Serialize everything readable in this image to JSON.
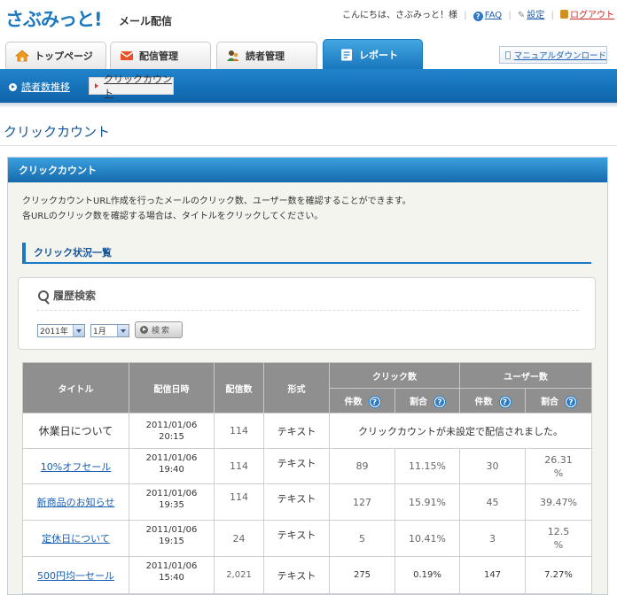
{
  "header": {
    "logo": "さぶみっと!",
    "logo_sub": "メール配信",
    "greeting": "こんにちは、さぶみっと！様",
    "faq": "FAQ",
    "settings": "設定",
    "logout": "ログアウト"
  },
  "tabs": [
    {
      "label": "トップページ",
      "icon": "home-icon"
    },
    {
      "label": "配信管理",
      "icon": "mail-icon"
    },
    {
      "label": "読者管理",
      "icon": "readers-icon"
    },
    {
      "label": "レポート",
      "icon": "report-icon",
      "active": true
    }
  ],
  "manual_download": "マニュアルダウンロード",
  "subnav": {
    "items": [
      "読者数推移"
    ],
    "current": "クリックカウント"
  },
  "page_title": "クリックカウント",
  "panel": {
    "title": "クリックカウント",
    "desc_line1": "クリックカウントURL作成を行ったメールのクリック数、ユーザー数を確認することができます。",
    "desc_line2": "各URLのクリック数を確認する場合は、タイトルをクリックしてください。",
    "section_title": "クリック状況一覧"
  },
  "search": {
    "title": "履歴検索",
    "year": "2011年",
    "month": "1月",
    "button": "検索"
  },
  "table": {
    "headers": {
      "title": "タイトル",
      "date": "配信日時",
      "count": "配信数",
      "format": "形式",
      "click_group": "クリック数",
      "user_group": "ユーザー数",
      "cases": "件数",
      "ratio": "割合",
      "help": "?"
    },
    "rows": [
      {
        "title": "休業日について",
        "linked": false,
        "date": "2011/01/06",
        "time": "20:15",
        "count": "114",
        "format": "テキスト",
        "note": "クリックカウントが未設定で配信されました。"
      },
      {
        "title": "10%オフセール",
        "linked": true,
        "date": "2011/01/06",
        "time": "19:40",
        "count": "114",
        "format": "テキスト",
        "clicks": "89",
        "click_ratio": "11.15%",
        "users": "30",
        "user_ratio": "26.31\n%"
      },
      {
        "title": "新商品のお知らせ",
        "linked": true,
        "date": "2011/01/06",
        "time": "19:35",
        "count": "114",
        "format": "テキスト",
        "clicks": "127",
        "click_ratio": "15.91%",
        "users": "45",
        "user_ratio": "39.47%"
      },
      {
        "title": "定休日について",
        "linked": true,
        "date": "2011/01/06",
        "time": "19:15",
        "count": "24",
        "format": "テキスト",
        "clicks": "5",
        "click_ratio": "10.41%",
        "users": "3",
        "user_ratio": "12.5\n%"
      },
      {
        "title": "500円均一セール",
        "linked": true,
        "date": "2011/01/06",
        "time": "15:40",
        "count": "2,021",
        "format": "テキスト",
        "clicks": "275",
        "click_ratio": "0.19%",
        "users": "147",
        "user_ratio": "7.27%"
      }
    ]
  }
}
